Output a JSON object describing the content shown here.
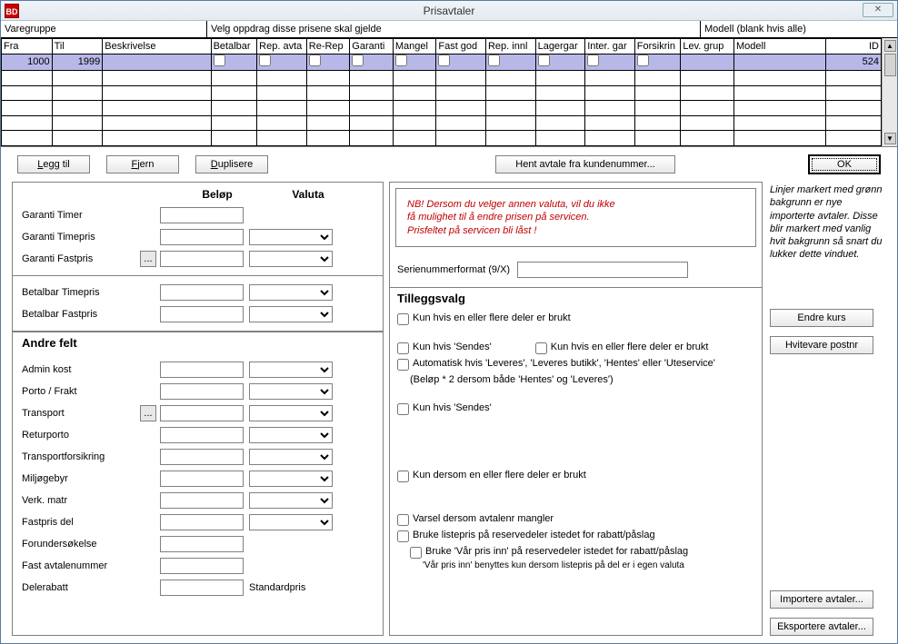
{
  "titlebar": {
    "title": "Prisavtaler",
    "icon_text": "BD"
  },
  "sections": {
    "varegruppe": "Varegruppe",
    "velg": "Velg oppdrag disse prisene skal gjelde",
    "modell": "Modell (blank hvis alle)"
  },
  "grid": {
    "headers": [
      "Fra",
      "Til",
      "Beskrivelse",
      "Betalbar",
      "Rep. avta",
      "Re-Rep",
      "Garanti",
      "Mangel",
      "Fast god",
      "Rep. innl",
      "Lagergar",
      "Inter. gar",
      "Forsikrin",
      "Lev. grup",
      "Modell",
      "ID"
    ],
    "row": {
      "fra": "1000",
      "til": "1999",
      "id": "524"
    }
  },
  "buttons": {
    "legg_til": "Legg til",
    "fjern": "Fjern",
    "duplisere": "Duplisere",
    "hent_avtale": "Hent avtale fra kundenummer...",
    "ok": "OK",
    "endre_kurs": "Endre kurs",
    "hvitevare": "Hvitevare postnr",
    "importere": "Importere avtaler...",
    "eksportere": "Eksportere avtaler..."
  },
  "cols": {
    "belop": "Beløp",
    "valuta": "Valuta"
  },
  "labels": {
    "garanti_timer": "Garanti Timer",
    "garanti_timepris": "Garanti Timepris",
    "garanti_fastpris": "Garanti Fastpris",
    "betalbar_timepris": "Betalbar Timepris",
    "betalbar_fastpris": "Betalbar Fastpris",
    "andre_felt": "Andre felt",
    "admin_kost": "Admin kost",
    "porto_frakt": "Porto / Frakt",
    "transport": "Transport",
    "returporto": "Returporto",
    "transportforsikring": "Transportforsikring",
    "miljogebyr": "Miljøgebyr",
    "verk_matr": "Verk. matr",
    "fastpris_del": "Fastpris del",
    "forundersokelse": "Forundersøkelse",
    "fast_avtalenummer": "Fast avtalenummer",
    "delerabatt": "Delerabatt",
    "standardpris": "Standardpris",
    "ellipsis": "..."
  },
  "warning": {
    "l1": "NB! Dersom du velger annen valuta, vil du ikke",
    "l2": "få mulighet til å endre prisen på servicen.",
    "l3": "Prisfeltet på servicen bli låst !"
  },
  "serieno": {
    "label": "Serienummerformat (9/X)"
  },
  "tilleggs": {
    "heading": "Tilleggsvalg",
    "kun_deler_brukt": "Kun hvis en eller flere deler er brukt",
    "kun_sendes": "Kun hvis 'Sendes'",
    "kun_deler_brukt2": "Kun hvis en eller flere deler er brukt",
    "auto_leveres": "Automatisk hvis 'Leveres', 'Leveres butikk', 'Hentes' eller 'Uteservice'",
    "auto_leveres_note": "(Beløp * 2 dersom både 'Hentes' og 'Leveres')",
    "kun_sendes2": "Kun hvis 'Sendes'",
    "kun_dersom_deler": "Kun dersom en eller flere deler er brukt",
    "varsel_avtalenr": "Varsel dersom avtalenr mangler",
    "bruke_listepris": "Bruke listepris på reservedeler istedet for rabatt/påslag",
    "bruke_var_pris": "Bruke 'Vår pris inn' på reservedeler istedet for rabatt/påslag",
    "var_pris_note": "'Vår pris inn' benyttes kun dersom listepris på del er i egen valuta"
  },
  "sidenote": "Linjer markert med grønn bakgrunn er nye importerte avtaler. Disse blir markert med vanlig hvit bakgrunn så snart du lukker dette vinduet."
}
